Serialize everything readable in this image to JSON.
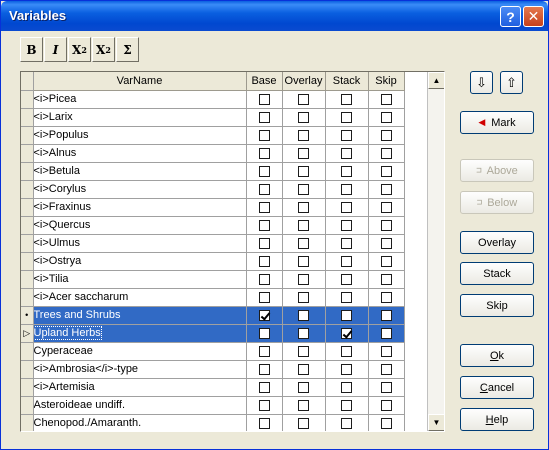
{
  "window": {
    "title": "Variables",
    "help_glyph": "?",
    "close_glyph": "✕"
  },
  "format_toolbar": {
    "bold": "B",
    "italic": "I",
    "superscript_base": "X",
    "superscript_sup": "2",
    "subscript_base": "X",
    "subscript_sub": "2",
    "sigma": "Σ"
  },
  "grid": {
    "columns": [
      "VarName",
      "Base",
      "Overlay",
      "Stack",
      "Skip"
    ],
    "rows": [
      {
        "indicator": "",
        "name": "<i>Picea",
        "base": false,
        "overlay": false,
        "stack": false,
        "skip": false
      },
      {
        "indicator": "",
        "name": "<i>Larix",
        "base": false,
        "overlay": false,
        "stack": false,
        "skip": false
      },
      {
        "indicator": "",
        "name": "<i>Populus",
        "base": false,
        "overlay": false,
        "stack": false,
        "skip": false
      },
      {
        "indicator": "",
        "name": "<i>Alnus",
        "base": false,
        "overlay": false,
        "stack": false,
        "skip": false
      },
      {
        "indicator": "",
        "name": "<i>Betula",
        "base": false,
        "overlay": false,
        "stack": false,
        "skip": false
      },
      {
        "indicator": "",
        "name": "<i>Corylus",
        "base": false,
        "overlay": false,
        "stack": false,
        "skip": false
      },
      {
        "indicator": "",
        "name": "<i>Fraxinus",
        "base": false,
        "overlay": false,
        "stack": false,
        "skip": false
      },
      {
        "indicator": "",
        "name": "<i>Quercus",
        "base": false,
        "overlay": false,
        "stack": false,
        "skip": false
      },
      {
        "indicator": "",
        "name": "<i>Ulmus",
        "base": false,
        "overlay": false,
        "stack": false,
        "skip": false
      },
      {
        "indicator": "",
        "name": "<i>Ostrya",
        "base": false,
        "overlay": false,
        "stack": false,
        "skip": false
      },
      {
        "indicator": "",
        "name": "<i>Tilia",
        "base": false,
        "overlay": false,
        "stack": false,
        "skip": false
      },
      {
        "indicator": "",
        "name": "<i>Acer saccharum",
        "base": false,
        "overlay": false,
        "stack": false,
        "skip": false
      },
      {
        "indicator": "•",
        "name": "Trees and Shrubs",
        "base": true,
        "overlay": false,
        "stack": false,
        "skip": false,
        "selected": true
      },
      {
        "indicator": "▷",
        "name": "Upland Herbs",
        "base": false,
        "overlay": false,
        "stack": true,
        "skip": false,
        "selected": true,
        "focus": true
      },
      {
        "indicator": "",
        "name": "Cyperaceae",
        "base": false,
        "overlay": false,
        "stack": false,
        "skip": false
      },
      {
        "indicator": "",
        "name": "<i>Ambrosia</i>-type",
        "base": false,
        "overlay": false,
        "stack": false,
        "skip": false
      },
      {
        "indicator": "",
        "name": "<i>Artemisia",
        "base": false,
        "overlay": false,
        "stack": false,
        "skip": false
      },
      {
        "indicator": "",
        "name": "Asteroideae undiff.",
        "base": false,
        "overlay": false,
        "stack": false,
        "skip": false
      },
      {
        "indicator": "",
        "name": "Chenopod./Amaranth.",
        "base": false,
        "overlay": false,
        "stack": false,
        "skip": false
      }
    ]
  },
  "buttons": {
    "move_down": "⇩",
    "move_up": "⇧",
    "mark": "Mark",
    "mark_icon": "◀",
    "above": "Above",
    "below": "Below",
    "overlay": "Overlay",
    "stack": "Stack",
    "skip": "Skip",
    "ok_u": "O",
    "ok_rest": "k",
    "cancel_u": "C",
    "cancel_rest": "ancel",
    "help_u": "H",
    "help_rest": "elp"
  },
  "colors": {
    "titlebar": "#0a5fe0",
    "selection": "#316ac5",
    "mark_arrow": "#d00000"
  }
}
